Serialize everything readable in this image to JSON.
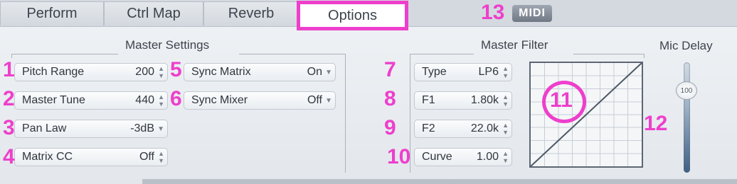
{
  "tabs": [
    {
      "label": "Perform"
    },
    {
      "label": "Ctrl Map"
    },
    {
      "label": "Reverb"
    },
    {
      "label": "Options",
      "active": true
    }
  ],
  "midi_label": "MIDI",
  "master_settings": {
    "title": "Master Settings",
    "left_fields": [
      {
        "label": "Pitch Range",
        "value": "200",
        "control": "stepper"
      },
      {
        "label": "Master Tune",
        "value": "440",
        "control": "stepper"
      },
      {
        "label": "Pan Law",
        "value": "-3dB",
        "control": "dropdown"
      },
      {
        "label": "Matrix CC",
        "value": "Off",
        "control": "stepper"
      }
    ],
    "right_fields": [
      {
        "label": "Sync Matrix",
        "value": "On",
        "control": "dropdown"
      },
      {
        "label": "Sync Mixer",
        "value": "Off",
        "control": "dropdown"
      }
    ]
  },
  "master_filter": {
    "title": "Master Filter",
    "fields": [
      {
        "label": "Type",
        "value": "LP6",
        "control": "stepper"
      },
      {
        "label": "F1",
        "value": "1.80k",
        "control": "stepper"
      },
      {
        "label": "F2",
        "value": "22.0k",
        "control": "stepper"
      },
      {
        "label": "Curve",
        "value": "1.00",
        "control": "stepper"
      }
    ]
  },
  "mic_delay": {
    "title": "Mic Delay",
    "value": "100",
    "level": 100
  },
  "annotations": [
    "1",
    "2",
    "3",
    "4",
    "5",
    "6",
    "7",
    "8",
    "9",
    "10",
    "11",
    "12",
    "13"
  ],
  "colors": {
    "highlight": "#ee3fcc",
    "panel": "#e8ecf0",
    "graph_line": "#4d5866"
  }
}
